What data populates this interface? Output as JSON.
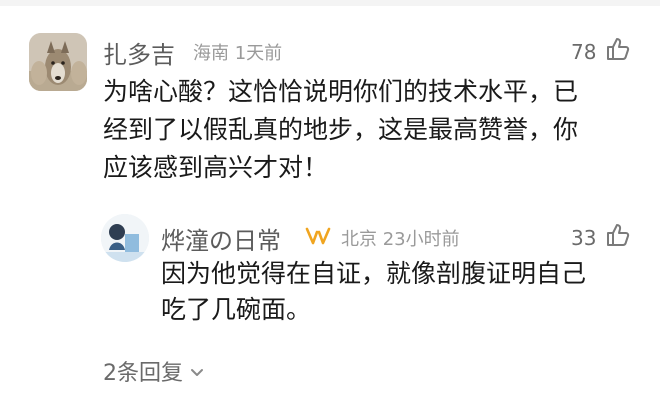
{
  "comment": {
    "author": "扎多吉",
    "location": "海南",
    "time": "1天前",
    "likes": "78",
    "text_lines": [
      "为啥心酸？这恰恰说明你们的技术水平，已",
      "经到了以假乱真的地步，这是最高赞誉，你",
      "应该感到高兴才对！"
    ]
  },
  "reply": {
    "author": "烨潼の日常",
    "location": "北京",
    "time": "23小时前",
    "likes": "33",
    "text_lines": [
      "因为他觉得在自证，就像剖腹证明自己",
      "吃了几碗面。"
    ]
  },
  "replies_link": {
    "label": "2条回复"
  },
  "icons": {
    "like": "thumbs-up-icon",
    "badge": "vip-badge-icon",
    "expand": "chevron-down-icon"
  },
  "colors": {
    "badge": "#f0a520",
    "meta": "#9a9a9a",
    "name": "#5c5c5c"
  }
}
